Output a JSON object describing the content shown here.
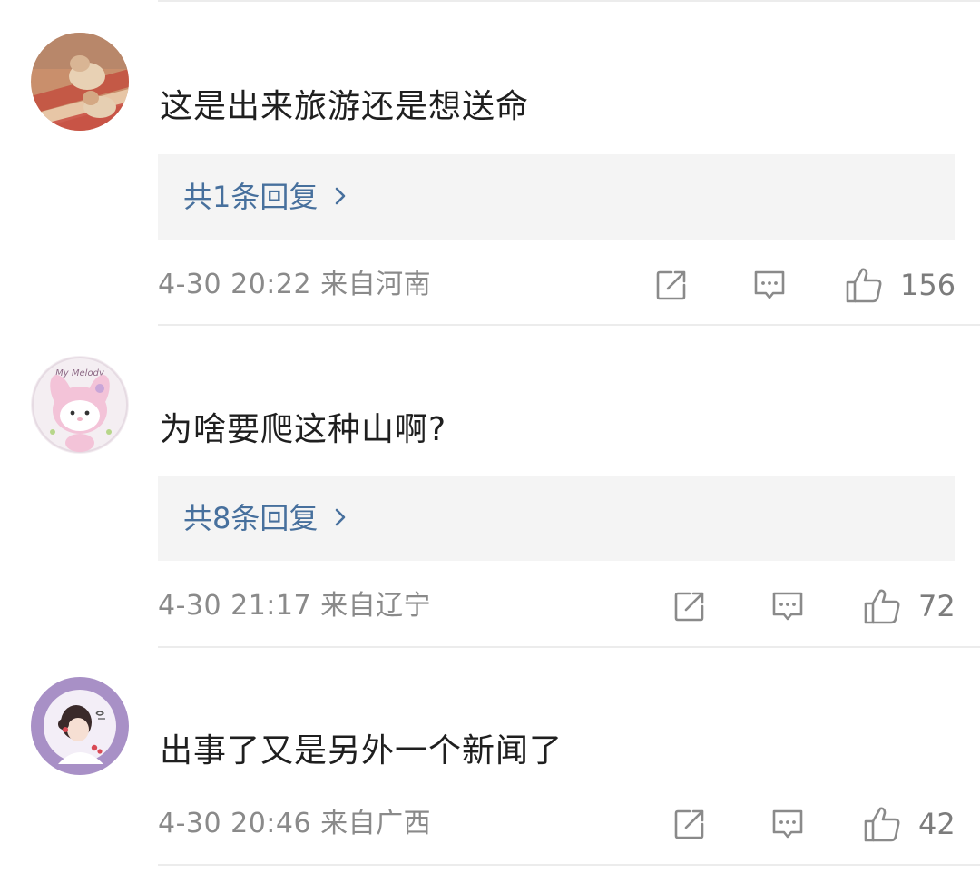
{
  "colors": {
    "link": "#47709d",
    "meta": "#8a8a8a",
    "reply_bg": "#f4f4f4",
    "divider": "#ececec"
  },
  "comments": [
    {
      "avatar_icon": "user-avatar-cat-photo",
      "text": "这是出来旅游还是想送命",
      "reply_label": "共1条回复",
      "time": "4-30 20:22",
      "location": "来自河南",
      "likes": "156"
    },
    {
      "avatar_icon": "user-avatar-my-melody",
      "avatar_text": "My Melody",
      "text": "为啥要爬这种山啊?",
      "reply_label": "共8条回复",
      "time": "4-30 21:17",
      "location": "来自辽宁",
      "likes": "72"
    },
    {
      "avatar_icon": "user-avatar-girl-illustration",
      "text": "出事了又是另外一个新闻了",
      "time": "4-30 20:46",
      "location": "来自广西",
      "likes": "42"
    }
  ]
}
